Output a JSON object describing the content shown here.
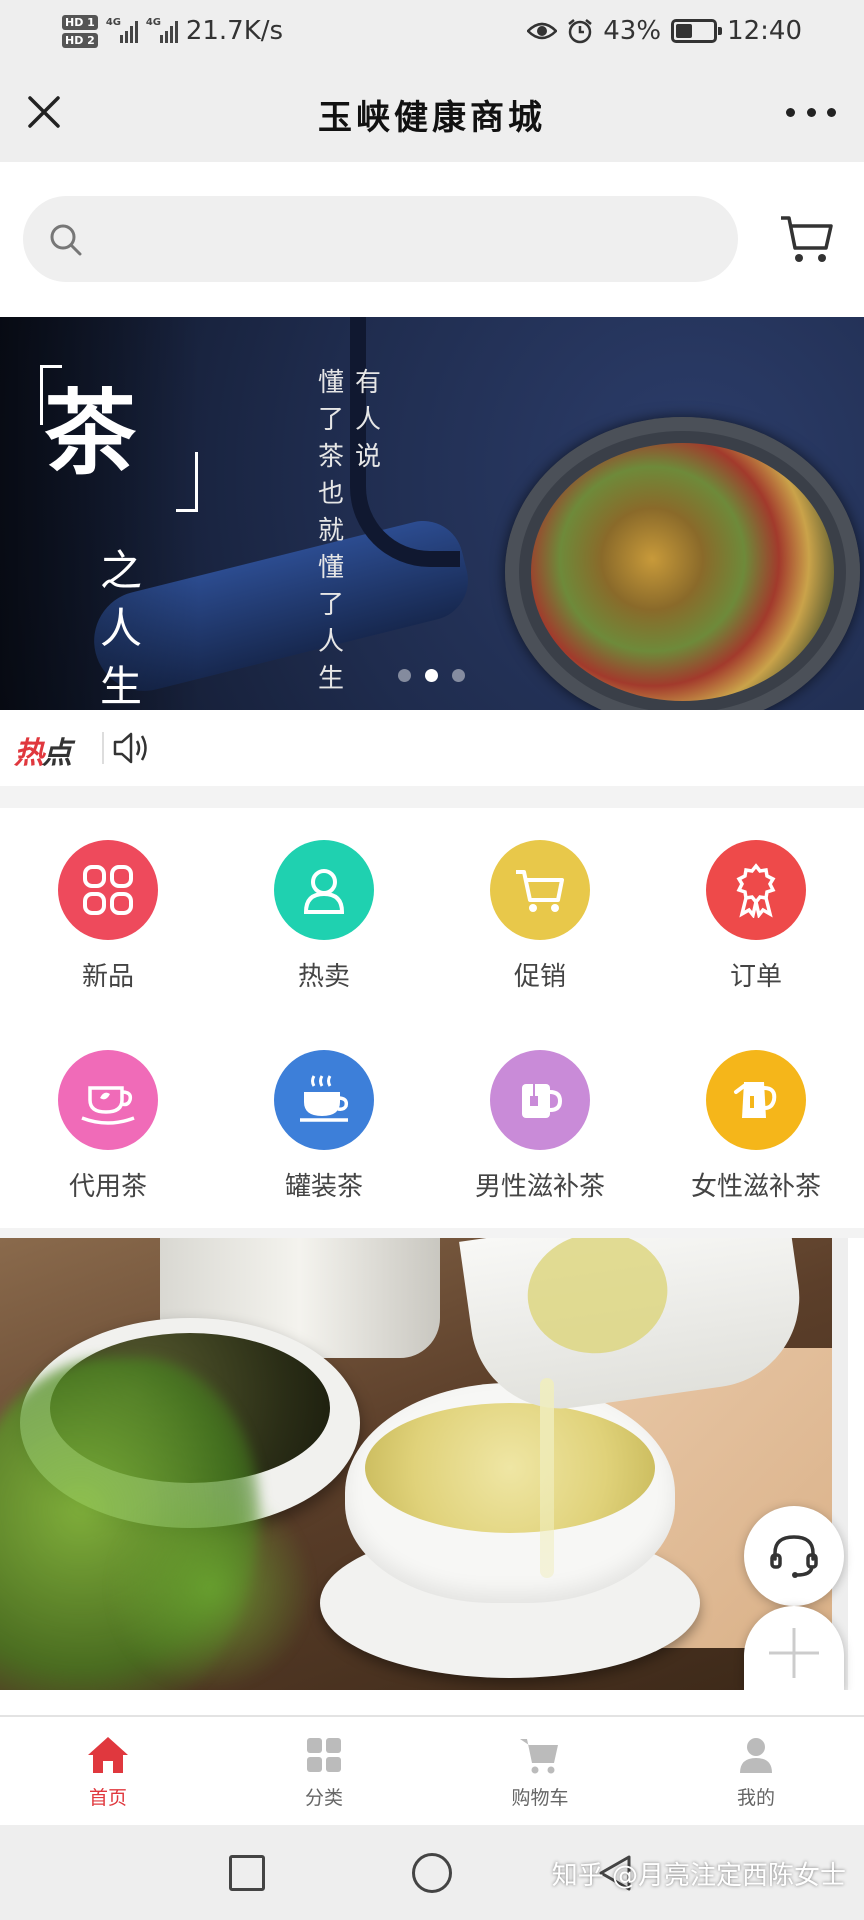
{
  "status_bar": {
    "hd1": "HD 1",
    "hd2": "HD 2",
    "net1": "4G",
    "net2": "4G",
    "speed": "21.7K/s",
    "battery": "43%",
    "battery_level": 0.43,
    "time": "12:40",
    "icons": [
      "eye-icon",
      "alarm-icon",
      "battery-icon"
    ]
  },
  "title_bar": {
    "title": "玉峡健康商城",
    "close_icon": "close-icon",
    "more_icon": "more-icon"
  },
  "search": {
    "placeholder": "",
    "icon": "search-icon",
    "cart_icon": "cart-icon"
  },
  "banner": {
    "headline": "茶",
    "subtitle": [
      "之",
      "人",
      "生"
    ],
    "poem_col_1": [
      "懂",
      "了",
      "茶",
      "也",
      "就",
      "懂",
      "了",
      "人",
      "生"
    ],
    "poem_col_2": [
      "有",
      "人",
      "说"
    ],
    "slide_count": 3,
    "active_slide": 2
  },
  "hot": {
    "badge_part1": "热",
    "badge_part2": "点",
    "icon": "speaker-icon"
  },
  "categories": [
    {
      "label": "新品",
      "icon": "grid-icon",
      "color": "#ee4a5c"
    },
    {
      "label": "热卖",
      "icon": "person-icon",
      "color": "#1fd1b0"
    },
    {
      "label": "促销",
      "icon": "cart-icon",
      "color": "#e8c84a"
    },
    {
      "label": "订单",
      "icon": "medal-icon",
      "color": "#ee4a4a"
    },
    {
      "label": "代用茶",
      "icon": "teacup-icon",
      "color": "#f06bb8"
    },
    {
      "label": "罐装茶",
      "icon": "hot-cup-icon",
      "color": "#3d7fd9"
    },
    {
      "label": "男性滋补茶",
      "icon": "tea-mug-icon",
      "color": "#c98bd8"
    },
    {
      "label": "女性滋补茶",
      "icon": "kettle-icon",
      "color": "#f5b61a"
    }
  ],
  "fabs": {
    "customer_service_icon": "headset-icon",
    "add_icon": "plus-icon"
  },
  "bottom_nav": [
    {
      "label": "首页",
      "icon": "home-icon",
      "active": true
    },
    {
      "label": "分类",
      "icon": "category-icon",
      "active": false
    },
    {
      "label": "购物车",
      "icon": "cart-icon",
      "active": false
    },
    {
      "label": "我的",
      "icon": "user-icon",
      "active": false
    }
  ],
  "system_nav": {
    "watermark": "知乎 @月亮注定西陈女士"
  },
  "colors": {
    "accent": "#e0383e",
    "bar_bg": "#eeeeee"
  }
}
